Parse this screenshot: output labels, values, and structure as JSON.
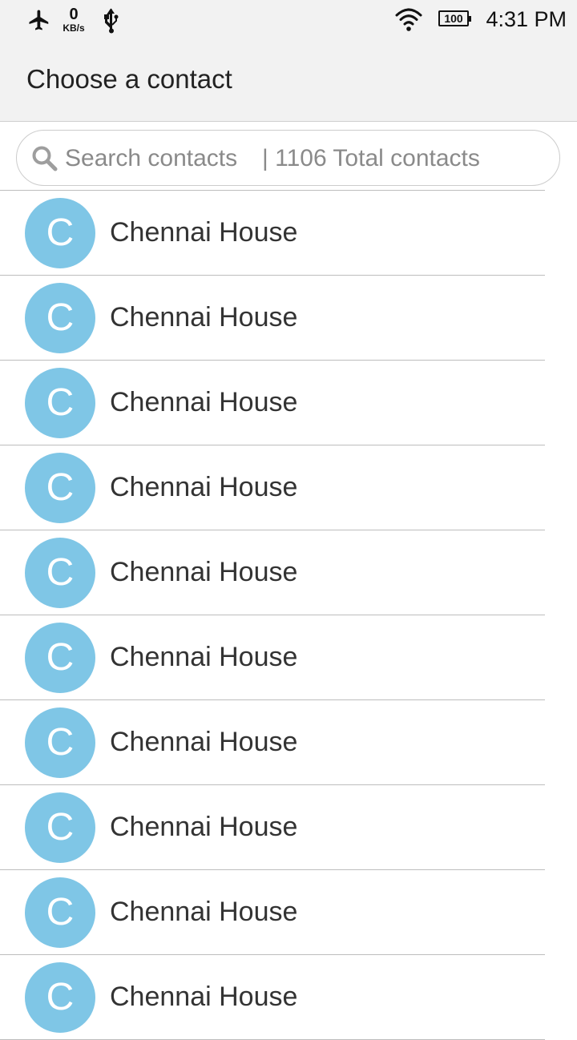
{
  "status_bar": {
    "network_speed_value": "0",
    "network_speed_unit": "KB/s",
    "battery_level": "100",
    "time": "4:31 PM",
    "icons": [
      "airplane-mode-icon",
      "usb-icon",
      "wifi-icon",
      "battery-icon"
    ]
  },
  "app_bar": {
    "title": "Choose a contact"
  },
  "search": {
    "placeholder": "Search contacts",
    "count_text": "| 1106 Total contacts"
  },
  "contacts": [
    {
      "initial": "C",
      "name": "Chennai House"
    },
    {
      "initial": "C",
      "name": "Chennai House"
    },
    {
      "initial": "C",
      "name": "Chennai House"
    },
    {
      "initial": "C",
      "name": "Chennai House"
    },
    {
      "initial": "C",
      "name": "Chennai House"
    },
    {
      "initial": "C",
      "name": "Chennai House"
    },
    {
      "initial": "C",
      "name": "Chennai House"
    },
    {
      "initial": "C",
      "name": "Chennai House"
    },
    {
      "initial": "C",
      "name": "Chennai House"
    },
    {
      "initial": "C",
      "name": "Chennai House"
    }
  ],
  "colors": {
    "avatar_background": "#7fc6e6",
    "app_bar_background": "#f2f2f2",
    "text_primary": "#333333",
    "text_hint": "#8a8a8a"
  }
}
